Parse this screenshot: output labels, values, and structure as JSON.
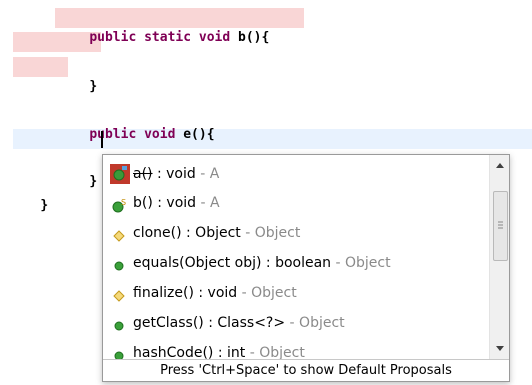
{
  "editor": {
    "lines": {
      "method_b_kw": "public static void",
      "method_b_rest": " b(){",
      "close_b": "}",
      "method_e_kw": "public void",
      "method_e_rest": " e(){",
      "close_e": "}",
      "close_class": "}"
    },
    "colors": {
      "keyword": "#7f0055",
      "highlight": "#f9d6d6",
      "current_line": "#e8f2fe"
    }
  },
  "content_assist": {
    "items": [
      {
        "name": "a()",
        "sig": " : void",
        "owner": " - A",
        "icon": "method-deprecated-icon"
      },
      {
        "name": "b()",
        "sig": " : void",
        "owner": " - A",
        "icon": "static-method-icon"
      },
      {
        "name": "clone()",
        "sig": " : Object",
        "owner": " - Object",
        "icon": "protected-method-icon"
      },
      {
        "name": "equals(Object obj)",
        "sig": " : boolean",
        "owner": " - Object",
        "icon": "public-method-icon"
      },
      {
        "name": "finalize()",
        "sig": " : void",
        "owner": " - Object",
        "icon": "protected-method-icon"
      },
      {
        "name": "getClass()",
        "sig": " : Class<?>",
        "owner": " - Object",
        "icon": "public-method-icon"
      },
      {
        "name": "hashCode()",
        "sig": " : int",
        "owner": " - Object",
        "icon": "public-method-icon"
      }
    ],
    "status": "Press 'Ctrl+Space' to show Default Proposals"
  }
}
